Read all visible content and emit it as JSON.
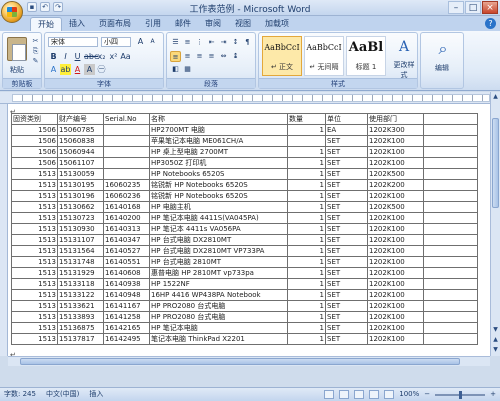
{
  "window": {
    "title": "工作表范例 - Microsoft Word"
  },
  "quick_access": [
    "save-icon",
    "undo-icon",
    "redo-icon"
  ],
  "tabs": [
    "开始",
    "插入",
    "页面布局",
    "引用",
    "邮件",
    "审阅",
    "视图",
    "加载项"
  ],
  "active_tab": "开始",
  "ribbon": {
    "clipboard": {
      "label": "剪贴板",
      "paste": "粘贴"
    },
    "font": {
      "label": "字体",
      "name": "宋体",
      "size": "小四"
    },
    "paragraph": {
      "label": "段落"
    },
    "styles": {
      "label": "样式",
      "items": [
        {
          "sample": "AaBbCcI",
          "name": "↵ 正文"
        },
        {
          "sample": "AaBbCcI",
          "name": "↵ 无间隔"
        },
        {
          "sample": "AaBl",
          "name": "标题 1"
        }
      ],
      "change": "更改样式"
    },
    "editing": {
      "label": "编辑"
    }
  },
  "table": {
    "headers": [
      "固资类别",
      "财产编号",
      "Serial.No",
      "名称",
      "数量",
      "单位",
      "使用部门"
    ],
    "rows": [
      [
        "1506",
        "15060785",
        "",
        "HP2700MT 电脑",
        "1",
        "EA",
        "1202K300"
      ],
      [
        "1506",
        "15060838",
        "",
        "苹果笔记本电脑 ME061CH/A",
        "",
        "SET",
        "1202K100"
      ],
      [
        "1506",
        "15060944",
        "",
        "HP 桌上型电脑 2700MT",
        "1",
        "SET",
        "1202K100"
      ],
      [
        "1506",
        "15061107",
        "",
        "HP3050Z 打印机",
        "1",
        "SET",
        "1202K100"
      ],
      [
        "1513",
        "15130059",
        "",
        "HP Notebooks 6520S",
        "1",
        "SET",
        "1202K500"
      ],
      [
        "1513",
        "15130195",
        "16060235",
        "铭锐新 HP Notebooks 6520S",
        "1",
        "SET",
        "1202K200"
      ],
      [
        "1513",
        "15130196",
        "16060236",
        "铭锐新 HP Notebooks 6520S",
        "1",
        "SET",
        "1202K100"
      ],
      [
        "1513",
        "15130662",
        "16140168",
        "HP 电脑主机",
        "1",
        "SET",
        "1202K500"
      ],
      [
        "1513",
        "15130723",
        "16140200",
        "HP 笔记本电脑 4411S(VA045PA)",
        "1",
        "SET",
        "1202K100"
      ],
      [
        "1513",
        "15130930",
        "16140313",
        "HP 笔记本 4411s VA056PA",
        "1",
        "SET",
        "1202K100"
      ],
      [
        "1513",
        "15131107",
        "16140347",
        "HP 台式电脑 DX2810MT",
        "1",
        "SET",
        "1202K100"
      ],
      [
        "1513",
        "15131564",
        "16140527",
        "HP 台式电脑 DX2810MT VP733PA",
        "1",
        "SET",
        "1202K100"
      ],
      [
        "1513",
        "15131748",
        "16140551",
        "HP 台式电脑 2810MT",
        "1",
        "SET",
        "1202K100"
      ],
      [
        "1513",
        "15131929",
        "16140608",
        "惠普电脑 HP 2810MT vp733pa",
        "1",
        "SET",
        "1202K100"
      ],
      [
        "1513",
        "15133118",
        "16140938",
        "HP 1522NF",
        "1",
        "SET",
        "1202K100"
      ],
      [
        "1513",
        "15133122",
        "16140948",
        "16HP 4416 WP438PA Notebook",
        "1",
        "SET",
        "1202K100"
      ],
      [
        "1513",
        "15133621",
        "16141167",
        "HP PRO2080 台式电脑",
        "1",
        "SET",
        "1202K100"
      ],
      [
        "1513",
        "15133893",
        "16141258",
        "HP PRO2080 台式电脑",
        "1",
        "SET",
        "1202K100"
      ],
      [
        "1513",
        "15136875",
        "16142165",
        "HP 笔记本电脑",
        "1",
        "SET",
        "1202K100"
      ],
      [
        "1513",
        "15137817",
        "16142495",
        "笔记本电脑 ThinkPad X2201",
        "1",
        "SET",
        "1202K100"
      ]
    ]
  },
  "status": {
    "words": "字数: 245",
    "language": "中文(中国)",
    "mode": "插入",
    "zoom": "100%"
  }
}
